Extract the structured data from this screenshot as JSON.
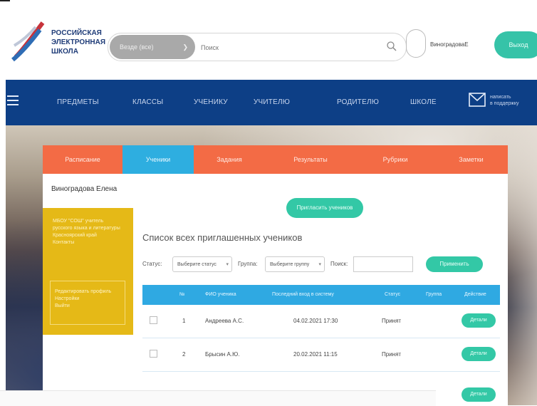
{
  "header": {
    "logo_lines": [
      "РОССИЙСКАЯ",
      "ЭЛЕКТРОННАЯ",
      "ШКОЛА"
    ],
    "search_select": "Везде (все)",
    "search_placeholder": "Поиск",
    "user_name": "ВиноградоваЕ",
    "login_label": "Выход"
  },
  "nav": {
    "items": [
      "ПРЕДМЕТЫ",
      "КЛАССЫ",
      "УЧЕНИКУ",
      "УЧИТЕЛЮ",
      "РОДИТЕЛЮ",
      "ШКОЛЕ"
    ],
    "mail_label_1": "написать",
    "mail_label_2": "в поддержку"
  },
  "tabs": [
    "Расписание",
    "Ученики",
    "Задания",
    "Результаты",
    "Рубрики",
    "Заметки"
  ],
  "active_tab": "Ученики",
  "sidebar": {
    "name": "Виноградова Елена",
    "info": "МБОУ \"СОШ\" учитель русского языка и литературы Красноярский край",
    "info_extra": "Контакты",
    "box_lines": [
      "Редактировать профиль",
      "Настройки",
      "Выйти"
    ]
  },
  "main": {
    "add_button": "Пригласить учеников",
    "list_title": "Список всех приглашенных учеников",
    "filter_status_label": "Статус:",
    "filter_status_value": "Выберите статус",
    "filter_group_label": "Группа:",
    "filter_group_value": "Выберите группу",
    "filter_search_label": "Поиск:",
    "apply_button": "Применить"
  },
  "table": {
    "headers": [
      "№",
      "ФИО ученика",
      "Последний вход в систему",
      "Статус",
      "Группа",
      "Действие"
    ],
    "rows": [
      {
        "num": "1",
        "name": "Андреева А.С.",
        "last_login": "04.02.2021 17:30",
        "status": "Принят",
        "group": "",
        "action": "Детали"
      },
      {
        "num": "2",
        "name": "Брысин А.Ю.",
        "last_login": "20.02.2021 11:15",
        "status": "Принят",
        "group": "",
        "action": "Детали"
      }
    ],
    "extra_action": "Детали"
  },
  "colors": {
    "nav_bg": "#0d3f86",
    "accent_green": "#33c8a6",
    "tab_orange": "#f36b45",
    "tab_active_blue": "#2eaee0",
    "sidebar_yellow": "#e5b917"
  }
}
